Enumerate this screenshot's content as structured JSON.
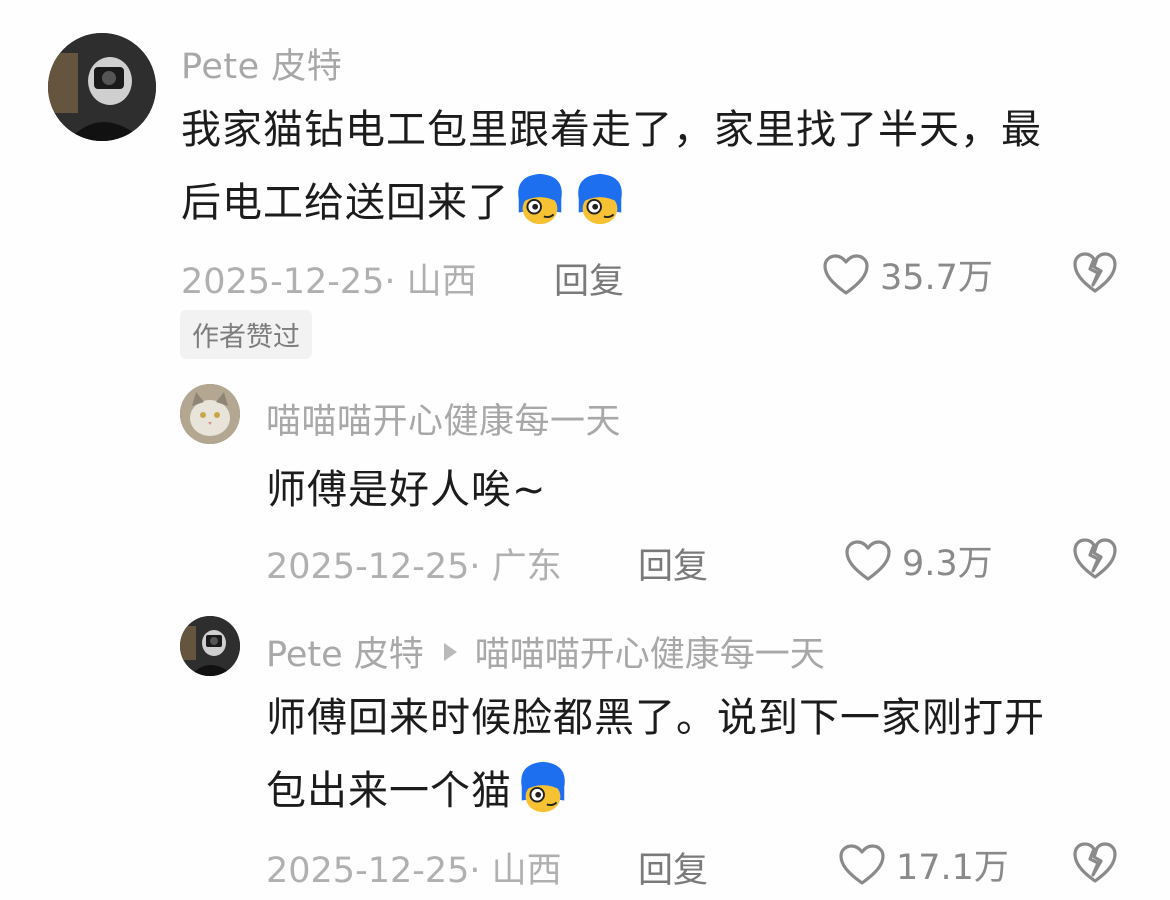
{
  "comments": [
    {
      "author": "Pete 皮特",
      "text_line1": "我家猫钻电工包里跟着走了，家里找了半天，最",
      "text_line2": "后电工给送回来了",
      "emojis": [
        "cool-face-emoji",
        "cool-face-emoji"
      ],
      "date_location": "2025-12-25· 山西",
      "reply_label": "回复",
      "likes": "35.7万",
      "badge": "作者赞过"
    },
    {
      "author": "喵喵喵开心健康每一天",
      "text": "师傅是好人唉~",
      "date_location": "2025-12-25· 广东",
      "reply_label": "回复",
      "likes": "9.3万"
    },
    {
      "author": "Pete 皮特",
      "reply_to": "喵喵喵开心健康每一天",
      "text_line1": "师傅回来时候脸都黑了。说到下一家刚打开",
      "text_line2": "包出来一个猫",
      "emojis": [
        "cool-face-emoji"
      ],
      "date_location": "2025-12-25· 山西",
      "reply_label": "回复",
      "likes": "17.1万"
    }
  ],
  "icons": {
    "like": "heart-outline-icon",
    "dislike": "broken-heart-icon",
    "reply_to": "triangle-right-icon"
  },
  "colors": {
    "name": "#a8a8a8",
    "text": "#1c1c1c",
    "meta": "#b0b0b0",
    "emoji_hair": "#1e6ff0",
    "emoji_face": "#f6c233"
  }
}
